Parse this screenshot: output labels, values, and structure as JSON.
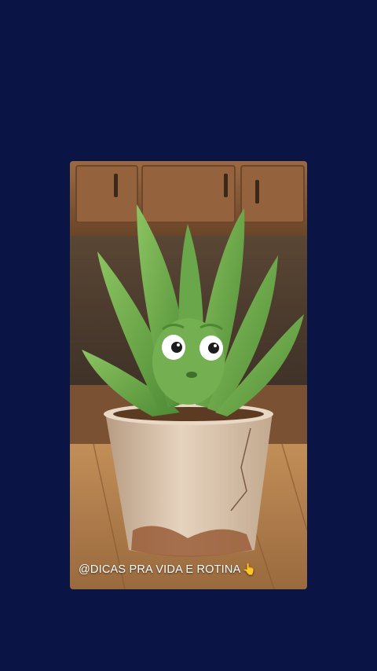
{
  "video": {
    "caption": "@DICAS PRA VIDA E ROTINA",
    "caption_emoji": "👆"
  },
  "colors": {
    "background": "#0b1545",
    "cabinet": "#8a5d3a",
    "table": "#b8834e",
    "pot": "#d9c4ad",
    "leaf": "#6aa64a"
  }
}
